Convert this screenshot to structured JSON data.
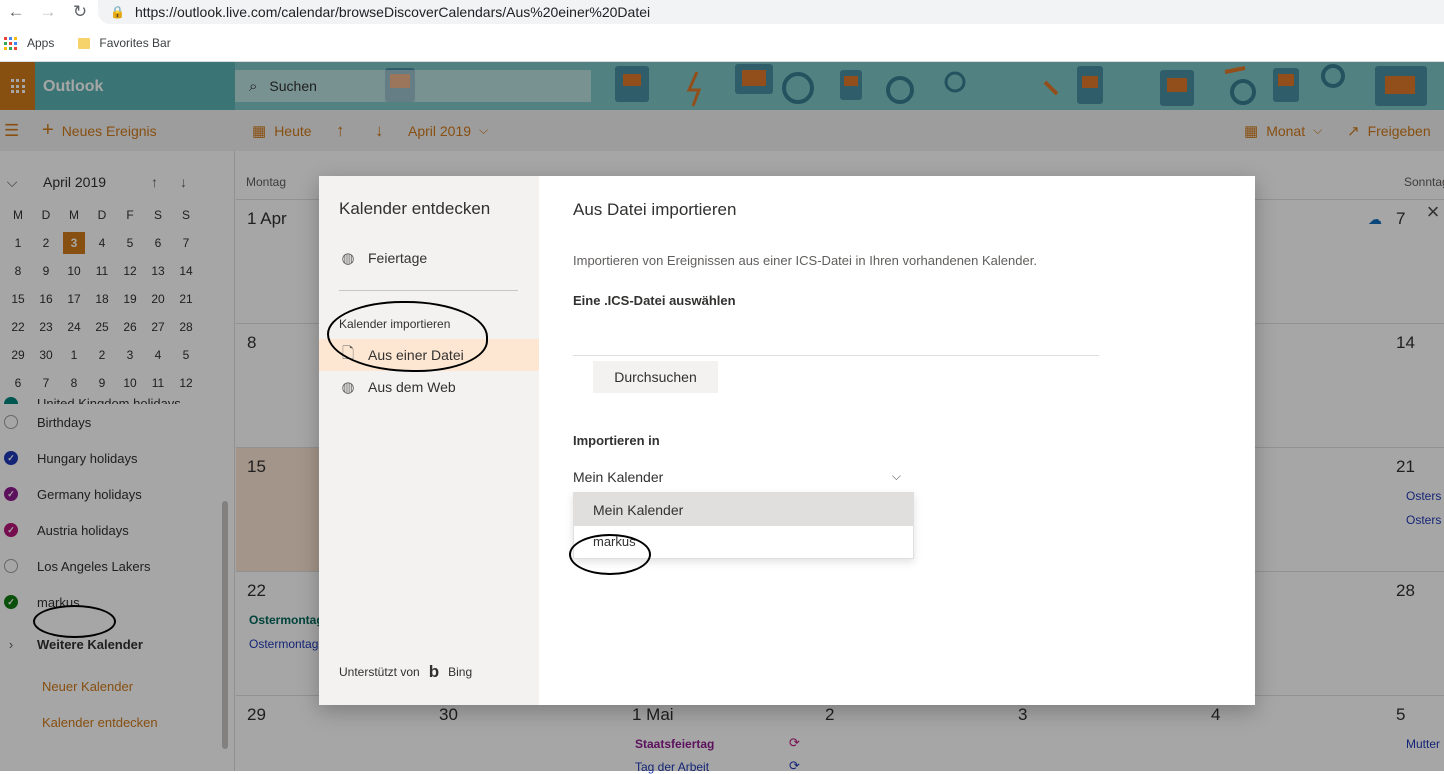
{
  "browser": {
    "url": "https://outlook.live.com/calendar/browseDiscoverCalendars/Aus%20einer%20Datei",
    "bookmarks": [
      "Apps",
      "Favorites Bar"
    ]
  },
  "header": {
    "brand": "Outlook",
    "search_placeholder": "Suchen"
  },
  "toolbar": {
    "new_event": "Neues Ereignis",
    "today": "Heute",
    "month_label": "April 2019",
    "view": "Monat",
    "share": "Freigeben"
  },
  "mini_calendar": {
    "title": "April 2019",
    "weekdays": [
      "M",
      "D",
      "M",
      "D",
      "F",
      "S",
      "S"
    ],
    "weeks": [
      [
        "1",
        "2",
        "3",
        "4",
        "5",
        "6",
        "7"
      ],
      [
        "8",
        "9",
        "10",
        "11",
        "12",
        "13",
        "14"
      ],
      [
        "15",
        "16",
        "17",
        "18",
        "19",
        "20",
        "21"
      ],
      [
        "22",
        "23",
        "24",
        "25",
        "26",
        "27",
        "28"
      ],
      [
        "29",
        "30",
        "1",
        "2",
        "3",
        "4",
        "5"
      ],
      [
        "6",
        "7",
        "8",
        "9",
        "10",
        "11",
        "12"
      ]
    ],
    "today": "3"
  },
  "calendars": {
    "partial_item": "United Kingdom holidays",
    "items": [
      {
        "label": "Birthdays",
        "color": "",
        "checked": false
      },
      {
        "label": "Hungary holidays",
        "color": "#1f38b5",
        "checked": true
      },
      {
        "label": "Germany holidays",
        "color": "#8e1b8e",
        "checked": true
      },
      {
        "label": "Austria holidays",
        "color": "#b5147a",
        "checked": true
      },
      {
        "label": "Los Angeles Lakers",
        "color": "",
        "checked": false
      },
      {
        "label": "markus",
        "color": "#107c10",
        "checked": true
      }
    ],
    "more": "Weitere Kalender",
    "new_calendar": "Neuer Kalender",
    "discover": "Kalender entdecken"
  },
  "grid": {
    "head_monday": "Montag",
    "head_sunday": "Sonntag",
    "mon": [
      "1 Apr",
      "8",
      "15",
      "22",
      "29"
    ],
    "sun": [
      "7",
      "14",
      "21",
      "28",
      "5"
    ],
    "bottom_row": [
      "30",
      "1 Mai",
      "2",
      "3",
      "4"
    ],
    "events": {
      "mon22_a": "Ostermontag",
      "mon22_b": "Ostermontag",
      "sun21_a": "Osters",
      "sun21_b": "Osters",
      "may1_a": "Staatsfeiertag",
      "may1_b": "Tag der Arbeit",
      "sun5": "Mutter"
    }
  },
  "dialog": {
    "left_title": "Kalender entdecken",
    "holidays": "Feiertage",
    "import_section": "Kalender importieren",
    "from_file": "Aus einer Datei",
    "from_web": "Aus dem Web",
    "powered_by": "Unterstützt von",
    "bing": "Bing",
    "title": "Aus Datei importieren",
    "description": "Importieren von Ereignissen aus einer ICS-Datei in Ihren vorhandenen Kalender.",
    "choose_file_label": "Eine .ICS-Datei auswählen",
    "browse": "Durchsuchen",
    "import_into_label": "Importieren in",
    "selected_calendar": "Mein Kalender",
    "options": [
      "Mein Kalender",
      "markus"
    ]
  }
}
